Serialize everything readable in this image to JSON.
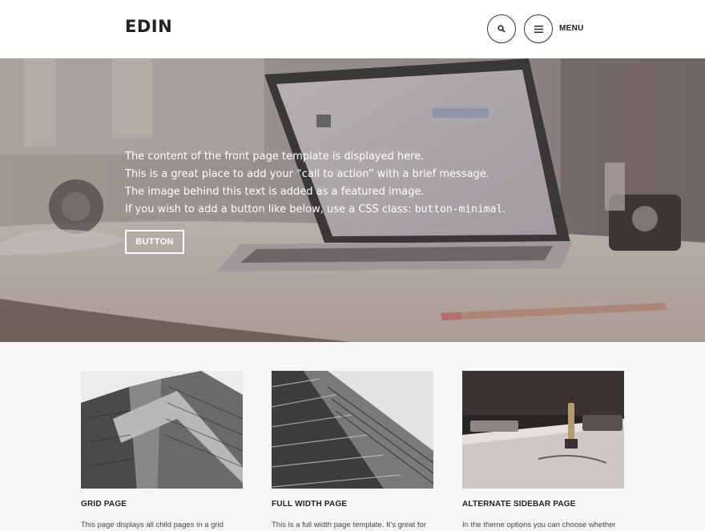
{
  "header": {
    "site_title": "EDIN",
    "menu_label": "MENU",
    "search_icon": "search-icon",
    "menu_icon": "hamburger-icon"
  },
  "hero": {
    "line1": "The content of the front page template is displayed here.",
    "line2": "This is a great place to add your “call to action” with a brief message.",
    "line3": "The image behind this text is added as a featured image.",
    "line4_prefix": "If you wish to add a button like below, use a CSS class: ",
    "line4_code": "button-minimal",
    "line4_suffix": ".",
    "button_label": "BUTTON"
  },
  "cards": [
    {
      "title": "GRID PAGE",
      "excerpt": "This page displays all child pages in a grid"
    },
    {
      "title": "FULL WIDTH PAGE",
      "excerpt": "This is a full width page template. It's great for"
    },
    {
      "title": "ALTERNATE SIDEBAR PAGE",
      "excerpt": "In the theme options you can choose whether"
    }
  ]
}
